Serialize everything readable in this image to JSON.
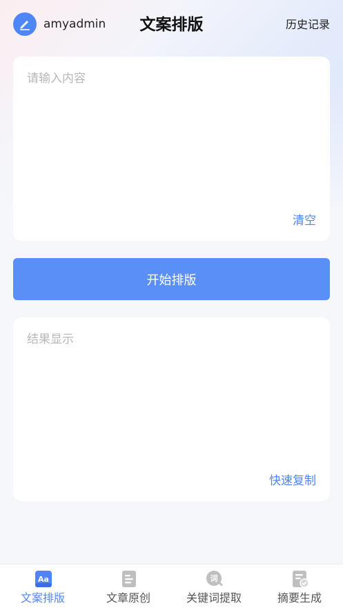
{
  "header": {
    "username": "amyadmin",
    "title": "文案排版",
    "history_label": "历史记录"
  },
  "input_card": {
    "placeholder": "请输入内容",
    "clear_label": "清空"
  },
  "start_button": {
    "label": "开始排版"
  },
  "result_card": {
    "placeholder": "结果显示",
    "copy_label": "快速复制"
  },
  "tabbar": {
    "items": [
      {
        "label": "文案排版",
        "icon": "format-icon",
        "active": true
      },
      {
        "label": "文章原创",
        "icon": "article-icon",
        "active": false
      },
      {
        "label": "关键词提取",
        "icon": "keyword-search-icon",
        "active": false
      },
      {
        "label": "摘要生成",
        "icon": "summary-icon",
        "active": false
      }
    ],
    "active_color": "#4f86f7",
    "inactive_color": "#555555"
  },
  "colors": {
    "accent": "#4f86f7",
    "button": "#5a8ff7",
    "icon_inactive": "#bfbfbf"
  }
}
